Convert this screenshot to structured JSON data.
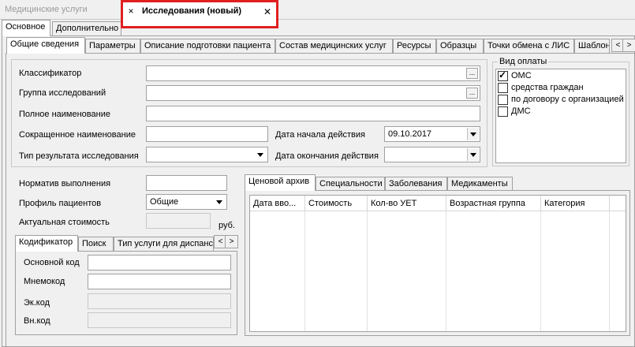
{
  "doc_tabs": {
    "inactive_title": "Медицинские услуги",
    "active_title": "Исследования (новый)",
    "close_glyph": "×",
    "close_glyph_right": "✕"
  },
  "main_tabs": [
    "Основное",
    "Дополнительно"
  ],
  "sub_tabs": [
    "Общие сведения",
    "Параметры",
    "Описание подготовки пациента",
    "Состав медицинских услуг",
    "Ресурсы",
    "Образцы",
    "Точки обмена с ЛИС",
    "Шаблон"
  ],
  "tab_scroll": {
    "left": "<",
    "right": ">"
  },
  "form": {
    "classifier_label": "Классификатор",
    "classifier_value": "",
    "group_label": "Группа исследований",
    "group_value": "",
    "full_name_label": "Полное наименование",
    "full_name_value": "",
    "short_name_label": "Сокращенное наименование",
    "short_name_value": "",
    "start_date_label": "Дата начала действия",
    "start_date_value": "09.10.2017",
    "end_date_label": "Дата окончания действия",
    "end_date_value": "",
    "result_type_label": "Тип результата исследования",
    "result_type_value": "",
    "ellipsis": "..."
  },
  "payment": {
    "title": "Вид оплаты",
    "options": [
      {
        "label": "ОМС",
        "checked": true
      },
      {
        "label": "средства граждан",
        "checked": false
      },
      {
        "label": "по договору с организацией",
        "checked": false
      },
      {
        "label": "ДМС",
        "checked": false
      }
    ]
  },
  "lower": {
    "norm_label": "Норматив выполнения",
    "norm_value": "",
    "profile_label": "Профиль пациентов",
    "profile_value": "Общие",
    "cost_label": "Актуальная стоимость",
    "cost_value": "",
    "cost_unit": "руб."
  },
  "code_tabs": [
    "Кодификатор",
    "Поиск",
    "Тип услуги для диспансеризации"
  ],
  "codes": {
    "main_label": "Основной код",
    "mnemo_label": "Мнемокод",
    "ek_label": "Эк.код",
    "vn_label": "Вн.код"
  },
  "price_tabs": [
    "Ценовой архив",
    "Специальности",
    "Заболевания",
    "Медикаменты"
  ],
  "price_grid": {
    "columns": [
      "Дата вво...",
      "Стоимость",
      "Кол-во УЕТ",
      "Возрастная группа",
      "Категория"
    ]
  }
}
